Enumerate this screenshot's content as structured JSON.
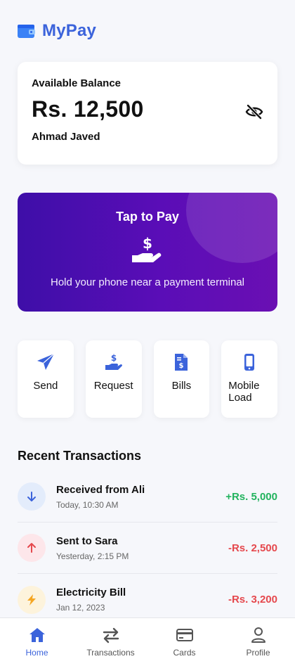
{
  "app": {
    "name": "MyPay",
    "logo_icon": "wallet-icon",
    "accent_color": "#3b63db"
  },
  "balance": {
    "label": "Available Balance",
    "amount": "Rs. 12,500",
    "holder_name": "Ahmad Javed",
    "visibility_icon": "eye-slash-icon"
  },
  "tap_to_pay": {
    "title": "Tap to Pay",
    "icon": "hand-dollar-icon",
    "subtitle": "Hold your phone near a payment terminal"
  },
  "actions": [
    {
      "label": "Send",
      "icon": "paper-plane-icon"
    },
    {
      "label": "Request",
      "icon": "hand-dollar-icon"
    },
    {
      "label": "Bills",
      "icon": "invoice-icon"
    },
    {
      "label": "Mobile Load",
      "icon": "mobile-icon"
    }
  ],
  "recent": {
    "title": "Recent Transactions",
    "items": [
      {
        "title": "Received from Ali",
        "time": "Today, 10:30 AM",
        "amount": "+Rs. 5,000",
        "direction": "received",
        "icon": "arrow-down-icon",
        "color": "#22b35e"
      },
      {
        "title": "Sent to Sara",
        "time": "Yesterday, 2:15 PM",
        "amount": "-Rs. 2,500",
        "direction": "sent",
        "icon": "arrow-up-icon",
        "color": "#e5484d"
      },
      {
        "title": "Electricity Bill",
        "time": "Jan 12, 2023",
        "amount": "-Rs. 3,200",
        "direction": "bill",
        "icon": "bolt-icon",
        "color": "#e5484d"
      }
    ]
  },
  "nav": {
    "items": [
      {
        "label": "Home",
        "icon": "home-icon",
        "active": true
      },
      {
        "label": "Transactions",
        "icon": "exchange-icon",
        "active": false
      },
      {
        "label": "Cards",
        "icon": "credit-card-icon",
        "active": false
      },
      {
        "label": "Profile",
        "icon": "user-icon",
        "active": false
      }
    ]
  }
}
